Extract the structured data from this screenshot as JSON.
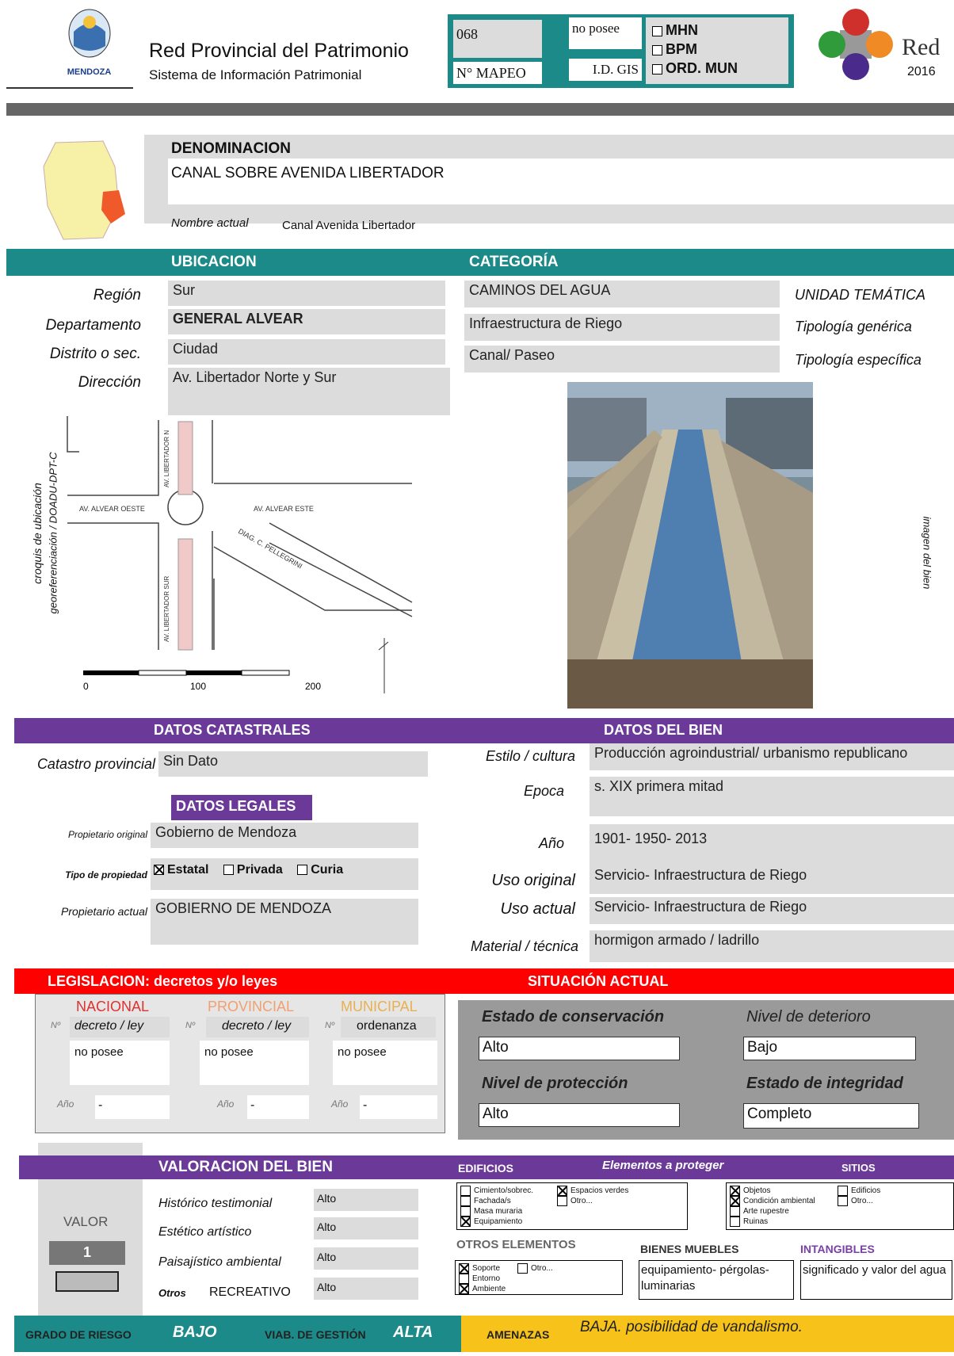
{
  "header": {
    "title": "Red Provincial del Patrimonio",
    "subtitle": "Sistema de Información Patrimonial",
    "logo_text": "MENDOZA",
    "mapeo_value": "068",
    "mapeo_label": "N° MAPEO",
    "gis_value": "no posee",
    "gis_label": "I.D. GIS",
    "checks": [
      "MHN",
      "BPM",
      "ORD. MUN"
    ],
    "red_logo": "Red",
    "red_year": "2016"
  },
  "denominacion": {
    "heading": "DENOMINACION",
    "value": "CANAL SOBRE AVENIDA LIBERTADOR",
    "nombre_label": "Nombre actual",
    "nombre_value": "Canal Avenida Libertador"
  },
  "ubicacion": {
    "heading": "UBICACION",
    "region_label": "Región",
    "region": "Sur",
    "depto_label": "Departamento",
    "depto": "GENERAL ALVEAR",
    "distrito_label": "Distrito  o sec.",
    "distrito": "Ciudad",
    "direccion_label": "Dirección",
    "direccion": "Av. Libertador Norte y Sur"
  },
  "categoria": {
    "heading": "CATEGORÍA",
    "unidad": "CAMINOS DEL AGUA",
    "unidad_label": "UNIDAD TEMÁTICA",
    "generica": "Infraestructura de Riego",
    "generica_label": "Tipología genérica",
    "especifica": "Canal/ Paseo",
    "especifica_label": "Tipología específica"
  },
  "map": {
    "side_label_1": "croquis de ubicación",
    "side_label_2": "georeferenciación / DOADU-DPT-C",
    "streets": [
      "AV. LIBERTADOR N",
      "AV. ALVEAR OESTE",
      "AV. ALVEAR ESTE",
      "DIAG. C. PELLEGRINI",
      "AV. LIBERTADOR SUR"
    ],
    "scale": [
      "0",
      "100",
      "200"
    ],
    "image_label": "imagen del bien"
  },
  "catastro": {
    "heading": "DATOS CATASTRALES",
    "label": "Catastro provincial",
    "value": "Sin Dato"
  },
  "legales": {
    "heading": "DATOS LEGALES",
    "prop_original_label": "Propietario original",
    "prop_original": "Gobierno de Mendoza",
    "tipo_label": "Tipo de propiedad",
    "tipos": [
      "Estatal",
      "Privada",
      "Curia"
    ],
    "prop_actual_label": "Propietario actual",
    "prop_actual": "GOBIERNO DE MENDOZA"
  },
  "bien": {
    "heading": "DATOS DEL BIEN",
    "estilo_label": "Estilo / cultura",
    "estilo": "Producción agroindustrial/ urbanismo republicano",
    "epoca_label": "Epoca",
    "epoca": "s. XIX primera mitad",
    "anio_label": "Año",
    "anio": "1901- 1950- 2013",
    "uso_orig_label": "Uso original",
    "uso_orig": "Servicio- Infraestructura de Riego",
    "uso_act_label": "Uso actual",
    "uso_act": "Servicio- Infraestructura de Riego",
    "material_label": "Material / técnica",
    "material": "hormigon armado / ladrillo"
  },
  "legislacion": {
    "heading": "LEGISLACION: decretos y/o leyes",
    "cols": [
      {
        "name": "NACIONAL",
        "color": "#e03030",
        "sub": "decreto / ley",
        "value": "no posee"
      },
      {
        "name": "PROVINCIAL",
        "color": "#f0a070",
        "sub": "decreto / ley",
        "value": "no posee"
      },
      {
        "name": "MUNICIPAL",
        "color": "#e8b050",
        "sub": "ordenanza",
        "value": "no posee"
      }
    ],
    "n_label": "Nº",
    "anio_label": "Año",
    "anio_value": "-"
  },
  "situacion": {
    "heading": "SITUACIÓN ACTUAL",
    "conservacion_label": "Estado de conservación",
    "conservacion": "Alto",
    "deterioro_label": "Nivel de deterioro",
    "deterioro": "Bajo",
    "proteccion_label": "Nivel de protección",
    "proteccion": "Alto",
    "integridad_label": "Estado de integridad",
    "integridad": "Completo"
  },
  "valoracion": {
    "heading": "VALORACION DEL BIEN",
    "valor_label": "VALOR",
    "valor": "1",
    "rows": [
      {
        "label": "Histórico  testimonial",
        "value": "Alto"
      },
      {
        "label": "Estético  artístico",
        "value": "Alto"
      },
      {
        "label": "Paisajístico  ambiental",
        "value": "Alto"
      }
    ],
    "otros_label": "Otros",
    "otros_name": "RECREATIVO",
    "otros_value": "Alto"
  },
  "proteger": {
    "edificios": "EDIFICIOS",
    "elementos": "Elementos a proteger",
    "sitios": "SITIOS",
    "edif_items": [
      "Cimiento/sobrec.",
      "Fachada/s",
      "Masa muraria",
      "Equipamiento",
      "Espacios verdes",
      "Otro..."
    ],
    "sitio_items": [
      "Objetos",
      "Condición ambiental",
      "Arte rupestre",
      "Ruinas",
      "Edificios",
      "Otro..."
    ],
    "otros": "OTROS ELEMENTOS",
    "otros_items": [
      "Soporte",
      "Entorno",
      "Ambiente",
      "Otro..."
    ],
    "muebles": "BIENES MUEBLES",
    "muebles_value": "equipamiento- pérgolas- luminarias",
    "intangibles": "INTANGIBLES",
    "intangibles_value": "significado y valor del agua"
  },
  "footer": {
    "riesgo_label": "GRADO DE RIESGO",
    "riesgo": "BAJO",
    "viab_label": "VIAB. DE GESTIÓN",
    "viab": "ALTA",
    "amenazas_label": "AMENAZAS",
    "amenazas": "BAJA. posibilidad de vandalismo."
  }
}
